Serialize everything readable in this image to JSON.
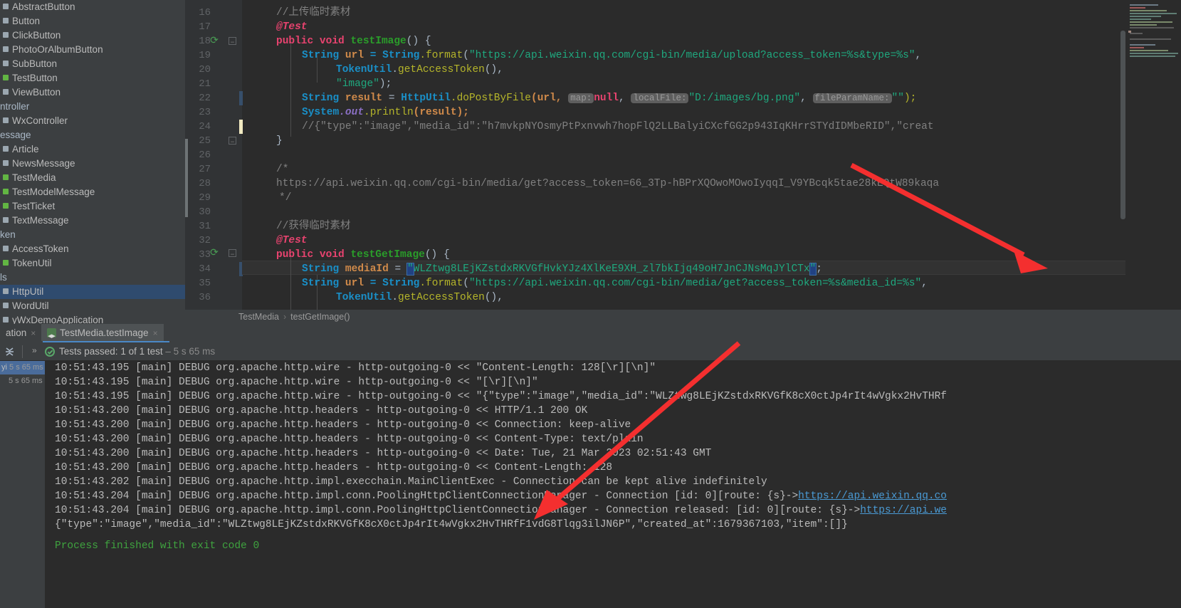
{
  "project_tree": {
    "items": [
      {
        "label": "AbstractButton",
        "icon": "class-icon",
        "kind": "class",
        "selected": false
      },
      {
        "label": "Button",
        "icon": "class-icon",
        "kind": "class",
        "selected": false
      },
      {
        "label": "ClickButton",
        "icon": "class-icon",
        "kind": "class",
        "selected": false
      },
      {
        "label": "PhotoOrAlbumButton",
        "icon": "class-icon",
        "kind": "class",
        "selected": false
      },
      {
        "label": "SubButton",
        "icon": "class-icon",
        "kind": "class",
        "selected": false
      },
      {
        "label": "TestButton",
        "icon": "test-class-icon",
        "kind": "test",
        "selected": false
      },
      {
        "label": "ViewButton",
        "icon": "class-icon",
        "kind": "class",
        "selected": false
      },
      {
        "label": "ntroller",
        "icon": "package-icon",
        "kind": "pkg",
        "selected": false
      },
      {
        "label": "WxController",
        "icon": "class-icon",
        "kind": "class",
        "selected": false
      },
      {
        "label": "essage",
        "icon": "package-icon",
        "kind": "pkg",
        "selected": false
      },
      {
        "label": "Article",
        "icon": "class-icon",
        "kind": "class",
        "selected": false
      },
      {
        "label": "NewsMessage",
        "icon": "class-icon",
        "kind": "class",
        "selected": false
      },
      {
        "label": "TestMedia",
        "icon": "test-class-icon",
        "kind": "test",
        "selected": false
      },
      {
        "label": "TestModelMessage",
        "icon": "test-class-icon",
        "kind": "test",
        "selected": false
      },
      {
        "label": "TestTicket",
        "icon": "test-class-icon",
        "kind": "test",
        "selected": false
      },
      {
        "label": "TextMessage",
        "icon": "class-icon",
        "kind": "class",
        "selected": false
      },
      {
        "label": "ken",
        "icon": "package-icon",
        "kind": "pkg",
        "selected": false
      },
      {
        "label": "AccessToken",
        "icon": "class-icon",
        "kind": "class",
        "selected": false
      },
      {
        "label": "TokenUtil",
        "icon": "test-class-icon",
        "kind": "test",
        "selected": false
      },
      {
        "label": "ls",
        "icon": "package-icon",
        "kind": "pkg",
        "selected": false
      },
      {
        "label": "HttpUtil",
        "icon": "class-icon",
        "kind": "class",
        "selected": true
      },
      {
        "label": "WordUtil",
        "icon": "class-icon",
        "kind": "class",
        "selected": false
      },
      {
        "label": "yWxDemoApplication",
        "icon": "class-icon",
        "kind": "class",
        "selected": false
      }
    ]
  },
  "editor": {
    "line_numbers": [
      "16",
      "17",
      "18",
      "19",
      "20",
      "21",
      "22",
      "23",
      "24",
      "25",
      "26",
      "27",
      "28",
      "29",
      "30",
      "31",
      "32",
      "33",
      "34",
      "35",
      "36"
    ],
    "breadcrumb": {
      "class": "TestMedia",
      "separator": "›",
      "method": "testGetImage()"
    },
    "lines": {
      "l16_comment": "//上传临时素材",
      "l17_annotation": "@Test",
      "l18_public": "public",
      "l18_void": "void",
      "l18_name": "testImage",
      "l18_tail": "() {",
      "l19_a": "String",
      "l19_b": "url",
      "l19_c": "= String",
      "l19_d": ".format",
      "l19_e": "(",
      "l19_str": "\"https://api.weixin.qq.com/cgi-bin/media/upload?access_token=%s&type=%s\"",
      "l19_f": ",",
      "l20_cls": "TokenUtil",
      "l20_dot": ".",
      "l20_m": "getAccessToken",
      "l20_tail": "(),",
      "l21_str": "\"image\"",
      "l21_tail": ");",
      "l22_a": "String",
      "l22_b": "result",
      "l22_c": "= ",
      "l22_cls": "HttpUtil",
      "l22_m": ".doPostByFile",
      "l22_arg1": "(url, ",
      "l22_h1": "map:",
      "l22_null": "null",
      "l22_sep1": ", ",
      "l22_h2": "localFile:",
      "l22_str1": "\"D:/images/bg.png\"",
      "l22_sep2": ", ",
      "l22_h3": "fileParamName:",
      "l22_str2": "\"\"",
      "l22_tail": ");",
      "l23_sys": "System",
      "l23_out": ".out",
      "l23_pr": ".println",
      "l23_tail": "(result);",
      "l24_comment": "//{\"type\":\"image\",\"media_id\":\"h7mvkpNYOsmyPtPxnvwh7hopFlQ2LLBalyiCXcfGG2p943IqKHrrSTYdIDMbeRID\",\"creat",
      "l25_brace": "}",
      "l27_open": "/*",
      "l28_url": "https://api.weixin.qq.com/cgi-bin/media/get?access_token=66_3Tp-hBPrXQOwoMOwoIyqqI_V9YBcqk5tae28kEQtW89kaqa",
      "l29_close": "*/",
      "l31_comment": "//获得临时素材",
      "l32_annotation": "@Test",
      "l33_public": "public",
      "l33_void": "void",
      "l33_name": "testGetImage",
      "l33_tail": "() {",
      "l34_a": "String",
      "l34_b": "mediaId",
      "l34_c": " = ",
      "l34_quote": "\"",
      "l34_val": "WLZtwg8LEjKZstdxRKVGfHvkYJz4XlKeE9XH_zl7bkIjq49oH7JnCJNsMqJYlCTx",
      "l34_quote2": "\"",
      "l34_tail": ";",
      "l35_a": "String",
      "l35_b": "url",
      "l35_c": "= String",
      "l35_d": ".format",
      "l35_e": "(",
      "l35_str": "\"https://api.weixin.qq.com/cgi-bin/media/get?access_token=%s&media_id=%s\"",
      "l35_f": ",",
      "l36_cls": "TokenUtil",
      "l36_dot": ".",
      "l36_m": "getAccessToken",
      "l36_tail": "(),"
    }
  },
  "run_tabs": [
    {
      "label": "ation",
      "close": "×",
      "active": false,
      "icon": "run-config-icon"
    },
    {
      "label": "TestMedia.testImage",
      "close": "×",
      "active": true,
      "icon": "junit-icon"
    }
  ],
  "test_status": {
    "collapse_icon": "collapse-all-icon",
    "chevrons": "»",
    "status_icon": "check-circle-icon",
    "passed_label": "Tests passed:",
    "passed_count": "1 of 1 test",
    "dash": "–",
    "duration": "5 s 65 ms"
  },
  "test_tree": [
    {
      "label": "yi",
      "duration": "5 s 65 ms",
      "selected": true
    },
    {
      "label": "",
      "duration": "5 s 65 ms",
      "selected": false
    }
  ],
  "console": {
    "logs": [
      "10:51:43.195 [main] DEBUG org.apache.http.wire - http-outgoing-0 << \"Content-Length: 128[\\r][\\n]\"",
      "10:51:43.195 [main] DEBUG org.apache.http.wire - http-outgoing-0 << \"[\\r][\\n]\"",
      "10:51:43.195 [main] DEBUG org.apache.http.wire - http-outgoing-0 << \"{\"type\":\"image\",\"media_id\":\"WLZtwg8LEjKZstdxRKVGfK8cX0ctJp4rIt4wVgkx2HvTHRf",
      "10:51:43.200 [main] DEBUG org.apache.http.headers - http-outgoing-0 << HTTP/1.1 200 OK",
      "10:51:43.200 [main] DEBUG org.apache.http.headers - http-outgoing-0 << Connection: keep-alive",
      "10:51:43.200 [main] DEBUG org.apache.http.headers - http-outgoing-0 << Content-Type: text/plain",
      "10:51:43.200 [main] DEBUG org.apache.http.headers - http-outgoing-0 << Date: Tue, 21 Mar 2023 02:51:43 GMT",
      "10:51:43.200 [main] DEBUG org.apache.http.headers - http-outgoing-0 << Content-Length: 128",
      "10:51:43.202 [main] DEBUG org.apache.http.impl.execchain.MainClientExec - Connection can be kept alive indefinitely"
    ],
    "log_link_1": {
      "text": "10:51:43.204 [main] DEBUG org.apache.http.impl.conn.PoolingHttpClientConnectionManager - Connection [id: 0][route: {s}->",
      "link": "https://api.weixin.qq.co"
    },
    "log_link_2": {
      "text": "10:51:43.204 [main] DEBUG org.apache.http.impl.conn.PoolingHttpClientConnectionManager - Connection released: [id: 0][route: {s}->",
      "link": "https://api.we"
    },
    "result_json": "{\"type\":\"image\",\"media_id\":\"WLZtwg8LEjKZstdxRKVGfK8cX0ctJp4rIt4wVgkx2HvTHRfF1vdG8Tlqg3ilJN6P\",\"created_at\":1679367103,\"item\":[]}",
    "exit_line": "Process finished with exit code 0"
  },
  "colors": {
    "bg_editor": "#2b2b2b",
    "bg_panel": "#3c3f41",
    "accent_blue": "#4a88c7",
    "pass_green": "#59a869",
    "arrow_red": "#f42f2f",
    "string_green": "#1fa97f",
    "keyword_orange": "#cc7832"
  },
  "annotation": {
    "arrow_1": "red-arrow-to-mediaid",
    "arrow_2": "red-arrow-to-result-json"
  }
}
